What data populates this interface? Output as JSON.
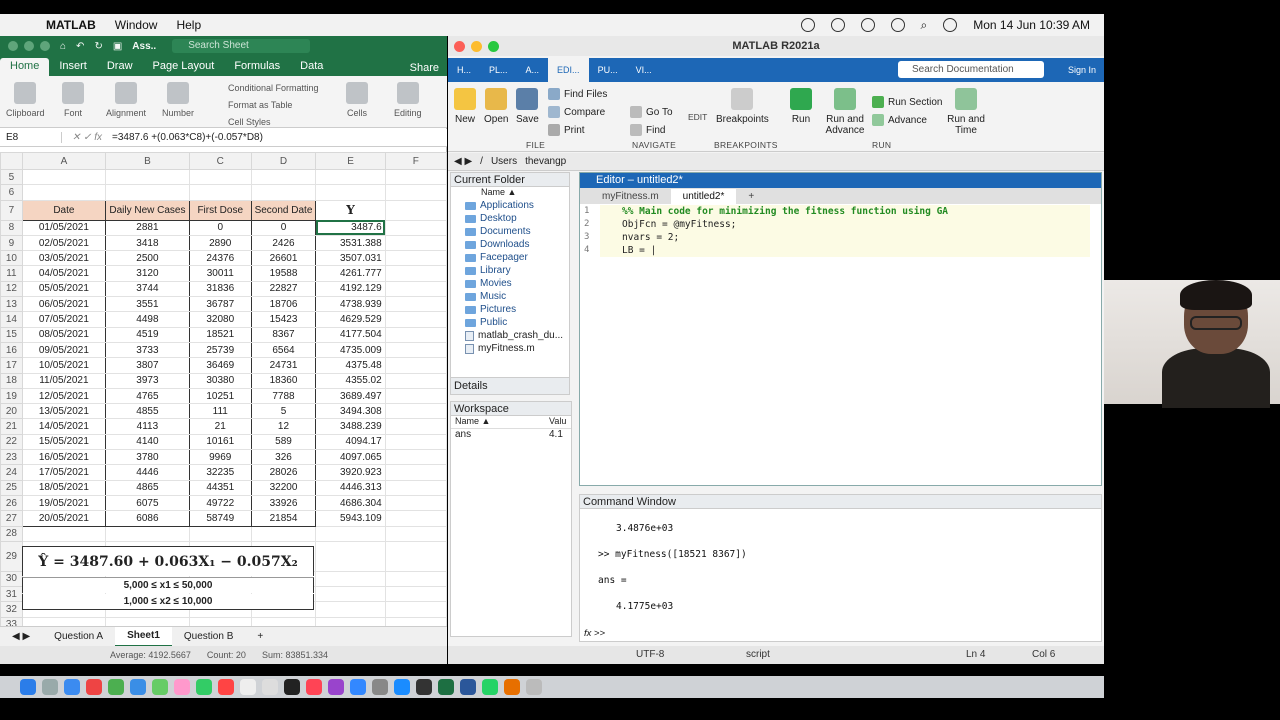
{
  "menubar": {
    "app": "MATLAB",
    "items": [
      "Window",
      "Help"
    ],
    "datetime": "Mon 14 Jun  10:39 AM"
  },
  "excel": {
    "search_placeholder": "Search Sheet",
    "title_short": "Ass..",
    "tabs": [
      "Home",
      "Insert",
      "Draw",
      "Page Layout",
      "Formulas",
      "Data"
    ],
    "share": "Share",
    "ribbon": {
      "clipboard": "Clipboard",
      "font": "Font",
      "alignment": "Alignment",
      "number": "Number",
      "cond_format": "Conditional Formatting",
      "format_table": "Format as Table",
      "cell_styles": "Cell Styles",
      "cells": "Cells",
      "editing": "Editing"
    },
    "name_box": "E8",
    "formula": "=3487.6 +(0.063*C8)+(-0.057*D8)",
    "col_headers": [
      "A",
      "B",
      "C",
      "D",
      "E",
      "F"
    ],
    "headers": {
      "date": "Date",
      "cases": "Daily New Cases",
      "first": "First Dose",
      "second": "Second Date",
      "y": "Y"
    },
    "rows": [
      {
        "n": "8",
        "date": "01/05/2021",
        "cases": "2881",
        "first": "0",
        "second": "0",
        "y": "3487.6"
      },
      {
        "n": "9",
        "date": "02/05/2021",
        "cases": "3418",
        "first": "2890",
        "second": "2426",
        "y": "3531.388"
      },
      {
        "n": "10",
        "date": "03/05/2021",
        "cases": "2500",
        "first": "24376",
        "second": "26601",
        "y": "3507.031"
      },
      {
        "n": "11",
        "date": "04/05/2021",
        "cases": "3120",
        "first": "30011",
        "second": "19588",
        "y": "4261.777"
      },
      {
        "n": "12",
        "date": "05/05/2021",
        "cases": "3744",
        "first": "31836",
        "second": "22827",
        "y": "4192.129"
      },
      {
        "n": "13",
        "date": "06/05/2021",
        "cases": "3551",
        "first": "36787",
        "second": "18706",
        "y": "4738.939"
      },
      {
        "n": "14",
        "date": "07/05/2021",
        "cases": "4498",
        "first": "32080",
        "second": "15423",
        "y": "4629.529"
      },
      {
        "n": "15",
        "date": "08/05/2021",
        "cases": "4519",
        "first": "18521",
        "second": "8367",
        "y": "4177.504"
      },
      {
        "n": "16",
        "date": "09/05/2021",
        "cases": "3733",
        "first": "25739",
        "second": "6564",
        "y": "4735.009"
      },
      {
        "n": "17",
        "date": "10/05/2021",
        "cases": "3807",
        "first": "36469",
        "second": "24731",
        "y": "4375.48"
      },
      {
        "n": "18",
        "date": "11/05/2021",
        "cases": "3973",
        "first": "30380",
        "second": "18360",
        "y": "4355.02"
      },
      {
        "n": "19",
        "date": "12/05/2021",
        "cases": "4765",
        "first": "10251",
        "second": "7788",
        "y": "3689.497"
      },
      {
        "n": "20",
        "date": "13/05/2021",
        "cases": "4855",
        "first": "111",
        "second": "5",
        "y": "3494.308"
      },
      {
        "n": "21",
        "date": "14/05/2021",
        "cases": "4113",
        "first": "21",
        "second": "12",
        "y": "3488.239"
      },
      {
        "n": "22",
        "date": "15/05/2021",
        "cases": "4140",
        "first": "10161",
        "second": "589",
        "y": "4094.17"
      },
      {
        "n": "23",
        "date": "16/05/2021",
        "cases": "3780",
        "first": "9969",
        "second": "326",
        "y": "4097.065"
      },
      {
        "n": "24",
        "date": "17/05/2021",
        "cases": "4446",
        "first": "32235",
        "second": "28026",
        "y": "3920.923"
      },
      {
        "n": "25",
        "date": "18/05/2021",
        "cases": "4865",
        "first": "44351",
        "second": "32200",
        "y": "4446.313"
      },
      {
        "n": "26",
        "date": "19/05/2021",
        "cases": "6075",
        "first": "49722",
        "second": "33926",
        "y": "4686.304"
      },
      {
        "n": "27",
        "date": "20/05/2021",
        "cases": "6086",
        "first": "58749",
        "second": "21854",
        "y": "5943.109"
      }
    ],
    "equation": "Ŷ = 3487.60 + 0.063X₁ − 0.057X₂",
    "constraint1": "5,000 ≤ x1 ≤ 50,000",
    "constraint2": "1,000 ≤ x2 ≤ 10,000",
    "sheets": [
      "Question A",
      "Sheet1",
      "Question B"
    ],
    "status": {
      "average": "Average: 4192.5667",
      "count": "Count: 20",
      "sum": "Sum: 83851.334"
    }
  },
  "matlab": {
    "title": "MATLAB R2021a",
    "tabs": [
      "H...",
      "PL...",
      "A...",
      "EDI...",
      "PU...",
      "VI..."
    ],
    "search_placeholder": "Search Documentation",
    "signin": "Sign In",
    "ribbon": {
      "new": "New",
      "open": "Open",
      "save": "Save",
      "find_files": "Find Files",
      "compare": "Compare",
      "print": "Print",
      "goto": "Go To",
      "find": "Find",
      "edit": "EDIT",
      "breakpoints": "Breakpoints",
      "run": "Run",
      "run_advance": "Run and Advance",
      "run_section": "Run Section",
      "advance": "Advance",
      "run_time": "Run and Time",
      "groups": [
        "FILE",
        "NAVIGATE",
        "BREAKPOINTS",
        "RUN"
      ]
    },
    "path": [
      "/",
      "Users",
      "thevangp"
    ],
    "current_folder": {
      "title": "Current Folder",
      "col": "Name ▲",
      "folders": [
        "Applications",
        "Desktop",
        "Documents",
        "Downloads",
        "Facepager",
        "Library",
        "Movies",
        "Music",
        "Pictures",
        "Public"
      ],
      "files": [
        "matlab_crash_du...",
        "myFitness.m"
      ]
    },
    "details": "Details",
    "workspace": {
      "title": "Workspace",
      "name_col": "Name ▲",
      "value_col": "Valu",
      "var": "ans",
      "val": "4.1"
    },
    "editor": {
      "title": "Editor – untitled2*",
      "tabs": [
        "myFitness.m",
        "untitled2*"
      ],
      "lines": [
        {
          "n": "1",
          "text": "%% Main code for minimizing the fitness function using GA"
        },
        {
          "n": "2",
          "text": "ObjFcn = @myFitness;"
        },
        {
          "n": "3",
          "text": "nvars = 2;"
        },
        {
          "n": "4",
          "text": "LB = |"
        }
      ]
    },
    "command": {
      "title": "Command Window",
      "lines": [
        "3.4876e+03",
        ">> myFitness([18521 8367])",
        "ans =",
        "4.1775e+03"
      ],
      "prompt": ">>"
    },
    "status": {
      "encoding": "UTF-8",
      "type": "script",
      "ln": "Ln  4",
      "col": "Col  6"
    }
  }
}
